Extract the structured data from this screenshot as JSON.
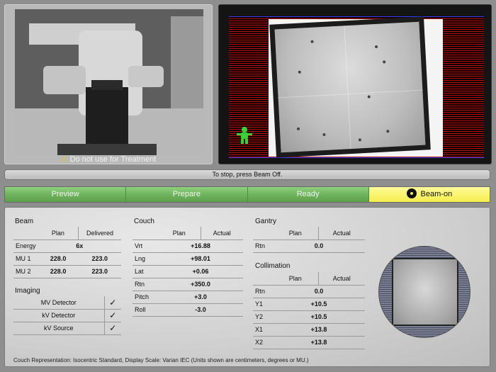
{
  "camera": {
    "warning": "Do not use for Treatment"
  },
  "status": {
    "message": "To stop, press Beam Off."
  },
  "workflow": {
    "steps": [
      "Preview",
      "Prepare",
      "Ready",
      "Beam-on"
    ],
    "active": "Beam-on"
  },
  "beam": {
    "title": "Beam",
    "col_plan": "Plan",
    "col_delivered": "Delivered",
    "energy_label": "Energy",
    "energy_value": "6x",
    "rows": [
      {
        "label": "MU 1",
        "plan": "228.0",
        "delivered": "223.0"
      },
      {
        "label": "MU 2",
        "plan": "228.0",
        "delivered": "223.0"
      }
    ]
  },
  "imaging": {
    "title": "Imaging",
    "rows": [
      {
        "label": "MV Detector",
        "check": "✓"
      },
      {
        "label": "kV Detector",
        "check": "✓"
      },
      {
        "label": "kV Source",
        "check": "✓"
      }
    ]
  },
  "couch": {
    "title": "Couch",
    "col_plan": "Plan",
    "col_actual": "Actual",
    "rows": [
      {
        "label": "Vrt",
        "value": "+16.88"
      },
      {
        "label": "Lng",
        "value": "+98.01"
      },
      {
        "label": "Lat",
        "value": "+0.06"
      },
      {
        "label": "Rtn",
        "value": "+350.0"
      },
      {
        "label": "Pitch",
        "value": "+3.0"
      },
      {
        "label": "Roll",
        "value": "-3.0"
      }
    ]
  },
  "gantry": {
    "title": "Gantry",
    "col_plan": "Plan",
    "col_actual": "Actual",
    "rows": [
      {
        "label": "Rtn",
        "value": "0.0"
      }
    ]
  },
  "collimation": {
    "title": "Collimation",
    "col_plan": "Plan",
    "col_actual": "Actual",
    "rows": [
      {
        "label": "Rtn",
        "value": "0.0"
      },
      {
        "label": "Y1",
        "value": "+10.5"
      },
      {
        "label": "Y2",
        "value": "+10.5"
      },
      {
        "label": "X1",
        "value": "+13.8"
      },
      {
        "label": "X2",
        "value": "+13.8"
      }
    ]
  },
  "footnote": "Couch Representation: Isocentric Standard, Display Scale: Varian IEC (Units shown are centimeters, degrees or MU.)"
}
